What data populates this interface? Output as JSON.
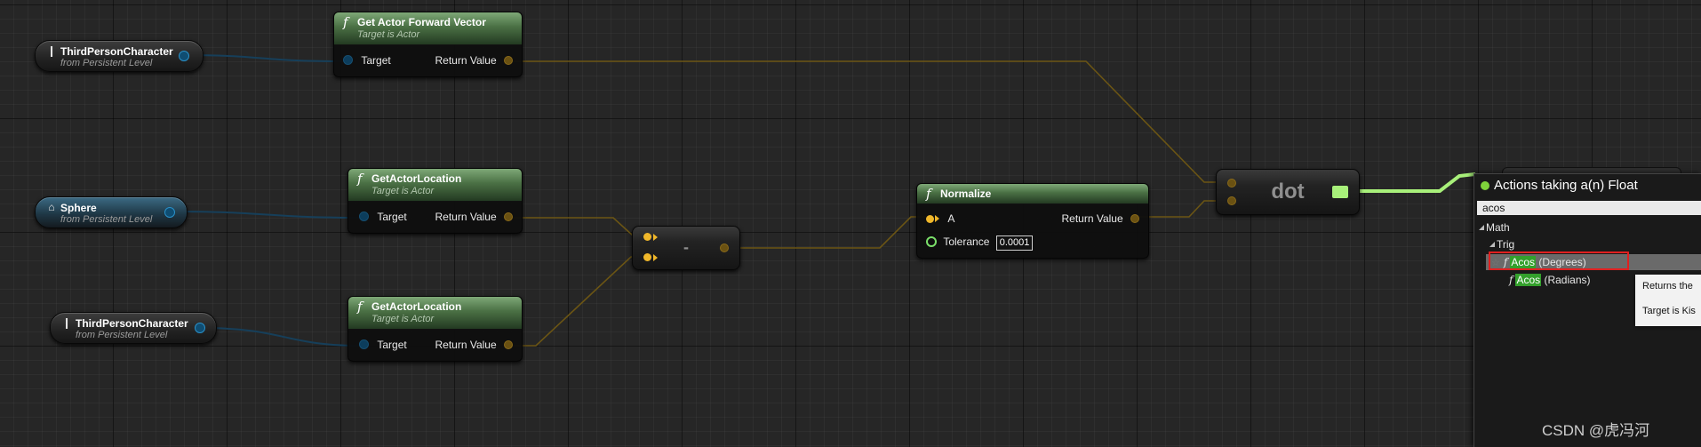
{
  "graph": {
    "var_nodes": [
      {
        "title": "ThirdPersonCharacter",
        "subtitle": "from Persistent Level"
      },
      {
        "title": "Sphere",
        "subtitle": "from Persistent Level"
      },
      {
        "title": "ThirdPersonCharacter",
        "subtitle": "from Persistent Level"
      }
    ],
    "function_nodes": [
      {
        "title": "Get Actor Forward Vector",
        "subtitle": "Target is Actor",
        "input": "Target",
        "output": "Return Value"
      },
      {
        "title": "GetActorLocation",
        "subtitle": "Target is Actor",
        "input": "Target",
        "output": "Return Value"
      },
      {
        "title": "GetActorLocation",
        "subtitle": "Target is Actor",
        "input": "Target",
        "output": "Return Value"
      },
      {
        "title": "Normalize",
        "input": "A",
        "output": "Return Value",
        "param_label": "Tolerance",
        "param_value": "0.0001"
      }
    ],
    "subtract_label": "-",
    "dot_label": "dot"
  },
  "action_menu": {
    "title": "Actions taking a(n) Float",
    "search": "acos",
    "category": "Math",
    "subcategory": "Trig",
    "items": [
      {
        "match": "Acos",
        "rest": " (Degrees)",
        "selected": true
      },
      {
        "match": "Acos",
        "rest": " (Radians)",
        "selected": false
      }
    ]
  },
  "tooltip": {
    "line1": "Returns the",
    "line2": "Target is Kis"
  },
  "watermark": "CSDN @虎冯河",
  "colors": {
    "vector_pin": "#f0b72a",
    "float_wire": "#a8f07a",
    "object_wire": "#1b5d85",
    "highlight": "#33a02c",
    "selection_box": "#e02020"
  },
  "icons": [
    "actor-icon",
    "sphere-icon",
    "function-icon",
    "star-icon",
    "tree-arrow-icon"
  ]
}
